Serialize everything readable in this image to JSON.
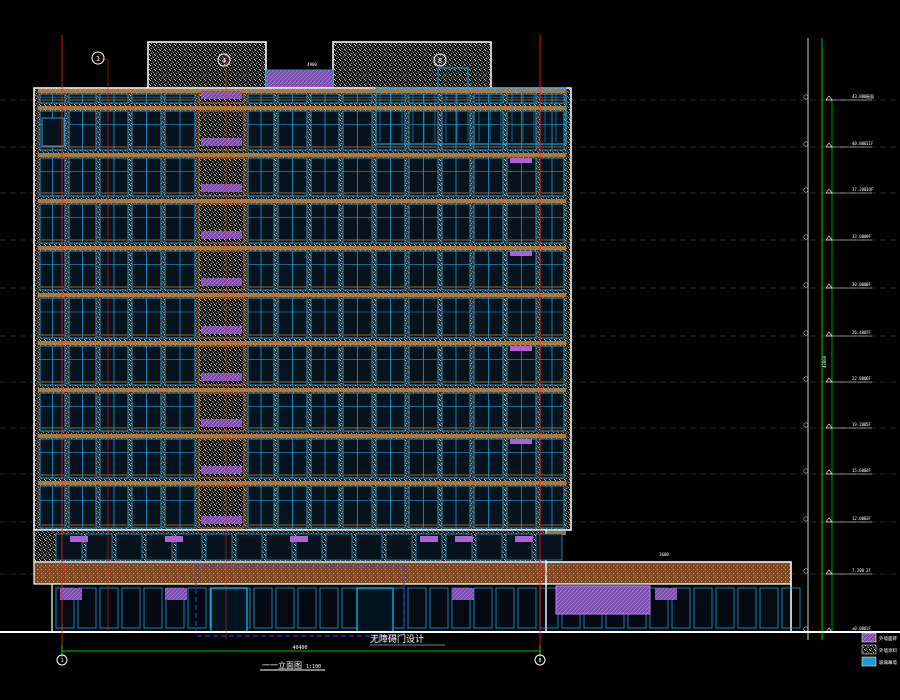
{
  "drawing": {
    "title": "一一立面图",
    "scale": "1:100",
    "annotation": "无障碍门设计",
    "overall_width": "40400",
    "canopy_dim": "3600",
    "roof_dim": "4900",
    "total_height": "43800"
  },
  "axes": {
    "left_top": "1",
    "mid_top": "4",
    "right_top": "8",
    "left_bottom": "1",
    "right_bottom": "8"
  },
  "levels": [
    {
      "elev": "43.800",
      "floor": "屋面"
    },
    {
      "elev": "40.800",
      "floor": "11F"
    },
    {
      "elev": "37.200",
      "floor": "10F"
    },
    {
      "elev": "33.600",
      "floor": "9F"
    },
    {
      "elev": "30.000",
      "floor": "8F"
    },
    {
      "elev": "26.400",
      "floor": "7F"
    },
    {
      "elev": "22.800",
      "floor": "6F"
    },
    {
      "elev": "19.200",
      "floor": "5F"
    },
    {
      "elev": "15.600",
      "floor": "4F"
    },
    {
      "elev": "12.000",
      "floor": "3F"
    },
    {
      "elev": "7.200",
      "floor": "2F"
    },
    {
      "elev": "±0.000",
      "floor": "1F"
    }
  ],
  "legend": [
    {
      "label": "外墙面砖"
    },
    {
      "label": "外墙涂料"
    },
    {
      "label": "玻璃幕墙"
    }
  ],
  "colors": {
    "background": "#000000",
    "outline": "#ffffff",
    "window": "#1e9bd7",
    "orange": "#c8823c",
    "magenta": "#b060d0",
    "red": "#ff2020",
    "green": "#00ff00",
    "stipple": "#b0b0b0"
  }
}
